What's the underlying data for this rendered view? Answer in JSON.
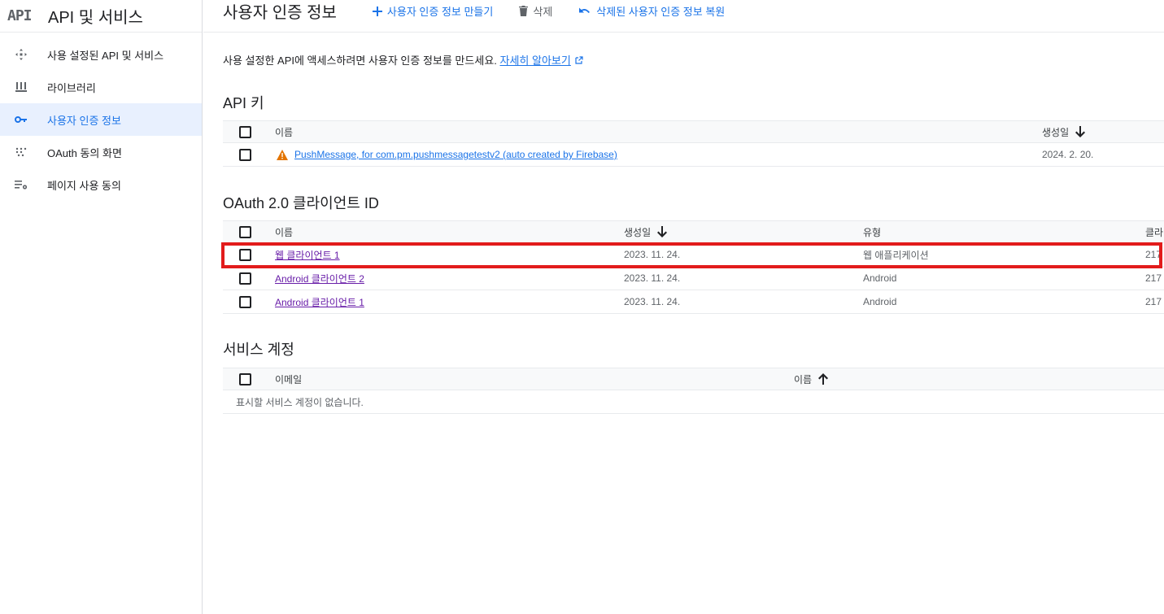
{
  "sidebar": {
    "logo": "API",
    "title": "API 및 서비스",
    "items": [
      {
        "label": "사용 설정된 API 및 서비스",
        "icon": "diamond-arrows-icon"
      },
      {
        "label": "라이브러리",
        "icon": "library-icon"
      },
      {
        "label": "사용자 인증 정보",
        "icon": "key-icon",
        "active": true
      },
      {
        "label": "OAuth 동의 화면",
        "icon": "dots-grid-icon"
      },
      {
        "label": "페이지 사용 동의",
        "icon": "settings-list-icon"
      }
    ]
  },
  "header": {
    "title": "사용자 인증 정보",
    "create_label": "사용자 인증 정보 만들기",
    "delete_label": "삭제",
    "restore_label": "삭제된 사용자 인증 정보 복원"
  },
  "intro": {
    "text": "사용 설정한 API에 액세스하려면 사용자 인증 정보를 만드세요.",
    "link": "자세히 알아보기"
  },
  "api_keys": {
    "title": "API 키",
    "headers": {
      "name": "이름",
      "created": "생성일"
    },
    "rows": [
      {
        "name": "PushMessage, for com.pm.pushmessagetestv2 (auto created by Firebase)",
        "created": "2024. 2. 20."
      }
    ]
  },
  "oauth": {
    "title": "OAuth 2.0 클라이언트 ID",
    "headers": {
      "name": "이름",
      "created": "생성일",
      "type": "유형",
      "client": "클라"
    },
    "rows": [
      {
        "name": "웹 클라이언트 1",
        "created": "2023. 11. 24.",
        "type": "웹 애플리케이션",
        "client": "217"
      },
      {
        "name": "Android 클라이언트 2",
        "created": "2023. 11. 24.",
        "type": "Android",
        "client": "217"
      },
      {
        "name": "Android 클라이언트 1",
        "created": "2023. 11. 24.",
        "type": "Android",
        "client": "217"
      }
    ]
  },
  "service_accounts": {
    "title": "서비스 계정",
    "headers": {
      "email": "이메일",
      "name": "이름"
    },
    "empty": "표시할 서비스 계정이 없습니다."
  },
  "colors": {
    "accent": "#1a73e8",
    "visited": "#681da8",
    "warning": "#e37400",
    "highlight": "#e21b1b"
  }
}
